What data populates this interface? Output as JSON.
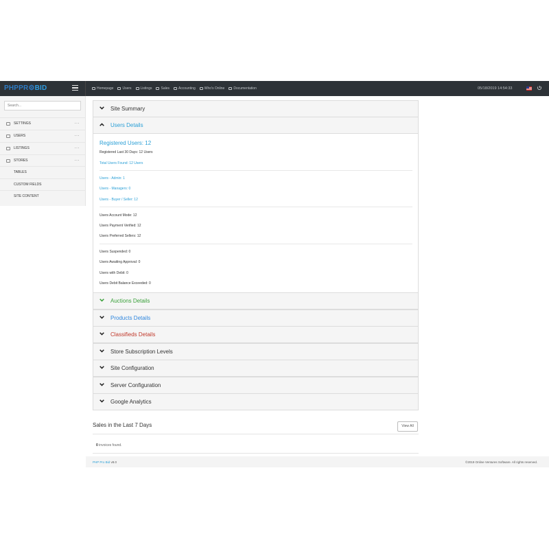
{
  "brand": {
    "part1": "PHP",
    "part2": "PR",
    "part3": "BID"
  },
  "topnav": [
    {
      "label": "Homepage",
      "icon": "monitor-icon"
    },
    {
      "label": "Users",
      "icon": "users-icon"
    },
    {
      "label": "Listings",
      "icon": "layers-icon"
    },
    {
      "label": "Sales",
      "icon": "calendar-icon"
    },
    {
      "label": "Accounting",
      "icon": "card-icon"
    },
    {
      "label": "Who's Online",
      "icon": "people-icon"
    },
    {
      "label": "Documentation",
      "icon": "book-icon"
    }
  ],
  "datetime": "05/18/2019 14:54:33",
  "search": {
    "placeholder": "Search..."
  },
  "sidebar": {
    "items": [
      {
        "label": "SETTINGS",
        "icon": "settings-icon",
        "menu": "···"
      },
      {
        "label": "USERS",
        "icon": "users-icon",
        "menu": "···"
      },
      {
        "label": "LISTINGS",
        "icon": "layers-icon",
        "menu": "···"
      },
      {
        "label": "STORES",
        "icon": "store-icon",
        "menu": "···"
      },
      {
        "label": "TABLES"
      },
      {
        "label": "CUSTOM FIELDS"
      },
      {
        "label": "SITE CONTENT"
      }
    ]
  },
  "accordion": {
    "site_summary": "Site Summary",
    "users_details": "Users Details",
    "auctions_details": "Auctions Details",
    "products_details": "Products Details",
    "classifieds_details": "Classifieds Details",
    "store_subscription": "Store Subscription Levels",
    "site_configuration": "Site Configuration",
    "server_configuration": "Server Configuration",
    "google_analytics": "Google Analytics"
  },
  "colors": {
    "auctions": "#3aa03a",
    "products": "#2e86de",
    "classifieds": "#c0392b",
    "users": "#2a9fd6"
  },
  "users": {
    "registered": "Registered Users: 12",
    "last30": "Registered Last 30 Days: 12 Users",
    "total_found": "Total Users Found: 12 Users",
    "admin": "Users - Admin: 1",
    "managers": "Users - Managers: 0",
    "buyer_seller": "Users - Buyer / Seller: 12",
    "account_mode": "Users Account Mode: 12",
    "payment_verified": "Users Payment Verified: 12",
    "preferred_sellers": "Users Preferred Sellers: 12",
    "suspended": "Users Suspended: 0",
    "awaiting_approval": "Users Awaiting Approval: 0",
    "with_debit": "Users with Debit: 0",
    "debit_exceeded": "Users Debit Balance Exceeded: 0"
  },
  "sales": {
    "title": "Sales in the Last 7 Days",
    "view_all": "View All",
    "count": "0",
    "found_text": "invoices found."
  },
  "footer": {
    "product": "PHP Pro Bid",
    "version": "v8.0",
    "copyright": "©2019 Online Ventures Software. All rights reserved."
  }
}
